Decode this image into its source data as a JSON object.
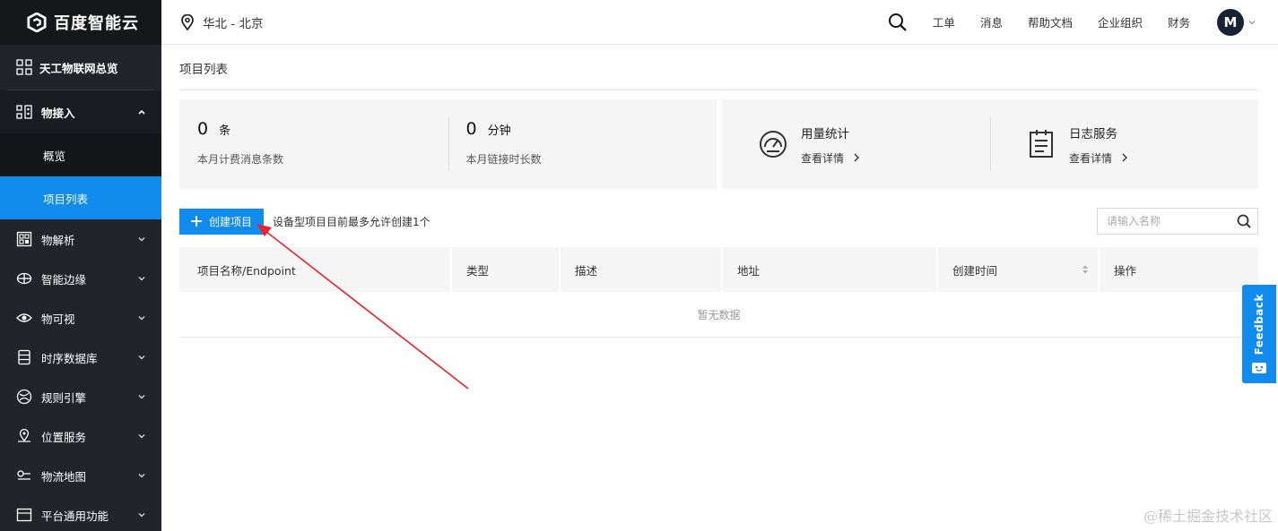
{
  "brand": {
    "name": "百度智能云"
  },
  "sidebar": {
    "overview": "天工物联网总览",
    "groups": [
      {
        "label": "物接入",
        "icon": "device-access-icon",
        "expanded": true,
        "children": [
          {
            "label": "概览",
            "active": false
          },
          {
            "label": "项目列表",
            "active": true
          }
        ]
      },
      {
        "label": "物解析",
        "icon": "parse-icon"
      },
      {
        "label": "智能边缘",
        "icon": "edge-icon"
      },
      {
        "label": "物可视",
        "icon": "eye-icon"
      },
      {
        "label": "时序数据库",
        "icon": "database-icon"
      },
      {
        "label": "规则引擎",
        "icon": "rule-engine-icon"
      },
      {
        "label": "位置服务",
        "icon": "location-service-icon"
      },
      {
        "label": "物流地图",
        "icon": "logistics-map-icon"
      },
      {
        "label": "平台通用功能",
        "icon": "platform-icon"
      }
    ]
  },
  "topbar": {
    "region": "华北 - 北京",
    "links": [
      "工单",
      "消息",
      "帮助文档",
      "企业组织",
      "财务"
    ],
    "avatar": "M"
  },
  "main": {
    "title": "项目列表",
    "stats": [
      {
        "value": "0",
        "unit": "条",
        "label": "本月计费消息条数"
      },
      {
        "value": "0",
        "unit": "分钟",
        "label": "本月链接时长数"
      }
    ],
    "services": [
      {
        "title": "用量统计",
        "link": "查看详情"
      },
      {
        "title": "日志服务",
        "link": "查看详情"
      }
    ],
    "create_button": "创建项目",
    "hint": "设备型项目目前最多允许创建1个",
    "search_placeholder": "请输入名称",
    "columns": [
      "项目名称/Endpoint",
      "类型",
      "描述",
      "地址",
      "创建时间",
      "操作"
    ],
    "empty_text": "暂无数据"
  },
  "feedback": {
    "label": "Feedback"
  },
  "watermark": "@稀土掘金技术社区",
  "colors": {
    "primary": "#108cee",
    "sidebar": "#22242a",
    "annotation": "#e8212e"
  }
}
